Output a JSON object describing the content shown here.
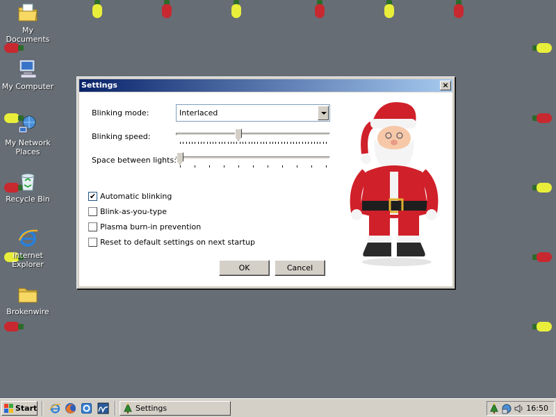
{
  "desktop": {
    "icons": [
      {
        "label": "My Documents"
      },
      {
        "label": "My Computer"
      },
      {
        "label": "My Network Places"
      },
      {
        "label": "Recycle Bin"
      },
      {
        "label": "Internet Explorer"
      },
      {
        "label": "Brokenwire"
      }
    ]
  },
  "dialog": {
    "title": "Settings",
    "close_glyph": "×",
    "blinking_mode_label": "Blinking mode:",
    "blinking_mode_value": "Interlaced",
    "blinking_speed_label": "Blinking speed:",
    "blinking_speed_level": 0.4,
    "space_label": "Space between lights:",
    "space_level": 0.0,
    "checkboxes": [
      {
        "label": "Automatic blinking",
        "checked": true
      },
      {
        "label": "Blink-as-you-type",
        "checked": false
      },
      {
        "label": "Plasma burn-in prevention",
        "checked": false
      },
      {
        "label": "Reset to default settings on next startup",
        "checked": false
      }
    ],
    "ok_label": "OK",
    "cancel_label": "Cancel"
  },
  "taskbar": {
    "start_label": "Start",
    "task_label": "Settings",
    "clock": "16:50"
  },
  "colors": {
    "desktop": "#666d75",
    "bulb_yellow": "#e8ee3a",
    "bulb_red": "#c8282f",
    "title_start": "#0a246a",
    "title_end": "#a6caf0"
  }
}
